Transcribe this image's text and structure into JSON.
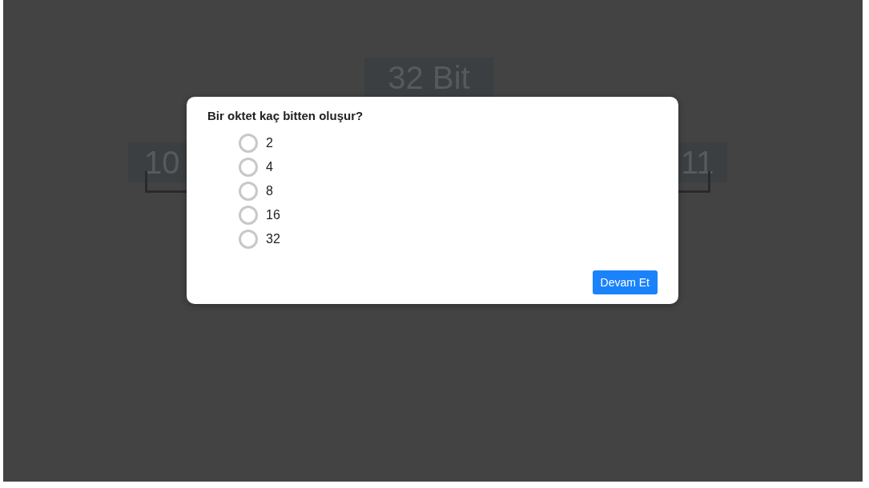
{
  "background": {
    "title": "32 Bit",
    "left_value": "10",
    "right_value": "11"
  },
  "dialog": {
    "question": "Bir oktet kaç bitten oluşur?",
    "options": [
      {
        "label": "2",
        "selected": false
      },
      {
        "label": "4",
        "selected": false
      },
      {
        "label": "8",
        "selected": false
      },
      {
        "label": "16",
        "selected": false
      },
      {
        "label": "32",
        "selected": false
      }
    ],
    "button": "Devam Et"
  }
}
